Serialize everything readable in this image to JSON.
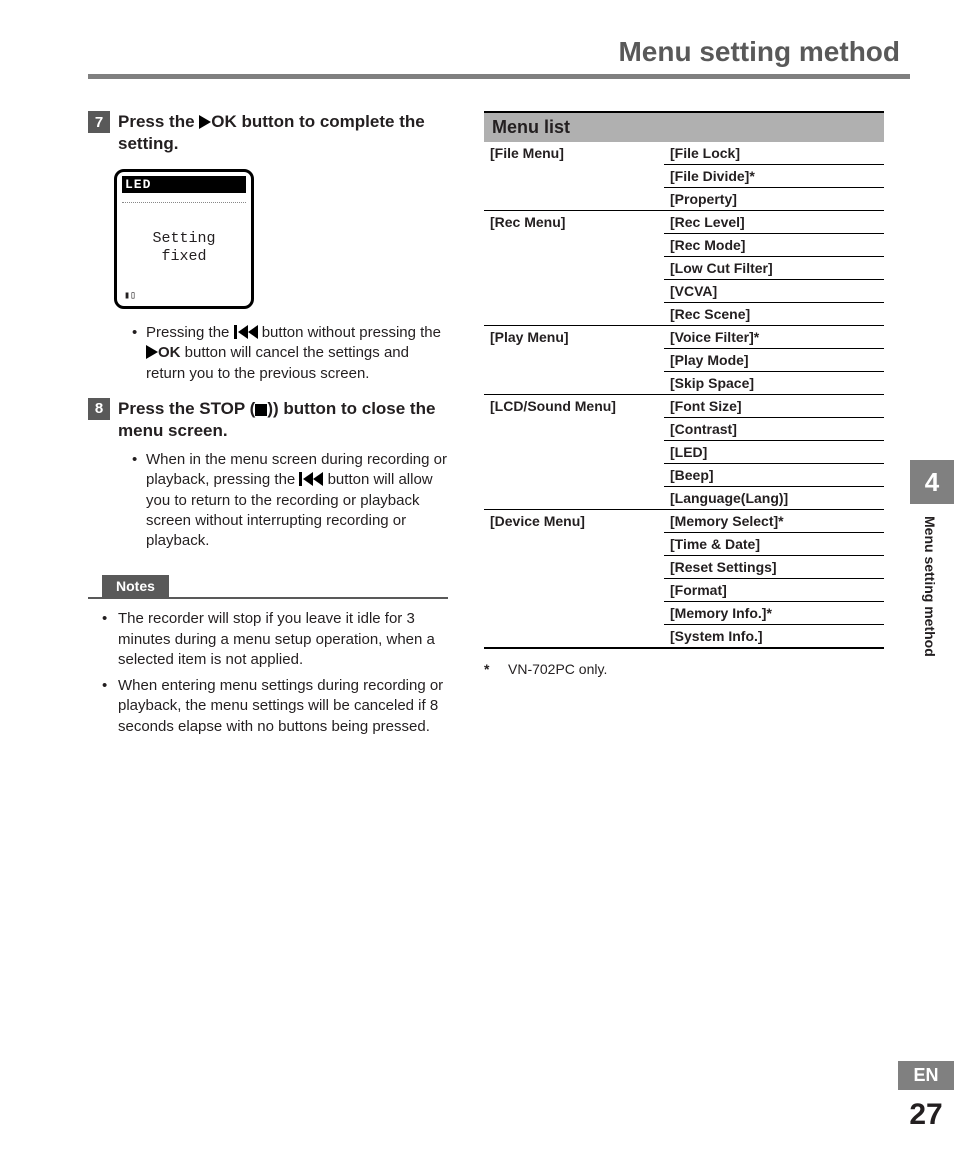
{
  "header": {
    "title": "Menu setting method"
  },
  "steps": {
    "s7": {
      "num": "7",
      "pre": "Press the ",
      "ok": "OK",
      "post": " button to complete the setting."
    },
    "s8": {
      "num": "8",
      "pre": "Press the ",
      "stop": "STOP (",
      "post": ") button to close the menu screen."
    }
  },
  "lcd": {
    "top": "LED",
    "line1": "Setting",
    "line2": "fixed"
  },
  "bullets": {
    "b7a_pre": "Pressing the ",
    "b7a_mid": " button without pressing the ",
    "b7a_ok": "OK",
    "b7a_post": " button will cancel the settings and return you to the previous screen.",
    "b8a_pre": "When in the menu screen during recording or playback, pressing the ",
    "b8a_post": " button will allow you to return to the recording or playback screen without interrupting recording or playback."
  },
  "notes": {
    "label": "Notes",
    "items": [
      "The recorder will stop if you leave it idle for 3 minutes during a menu setup operation, when a selected item is not applied.",
      "When entering menu settings during recording or playback, the menu settings will be canceled if 8 seconds elapse with no buttons being pressed."
    ]
  },
  "menulist": {
    "header": "Menu list",
    "rows": [
      {
        "cat": "[File Menu]",
        "item": "[File Lock]"
      },
      {
        "cat": "",
        "item": "[File Divide]*"
      },
      {
        "cat": "",
        "item": "[Property]"
      },
      {
        "cat": "[Rec Menu]",
        "item": "[Rec Level]",
        "line": true
      },
      {
        "cat": "",
        "item": "[Rec Mode]"
      },
      {
        "cat": "",
        "item": "[Low Cut Filter]"
      },
      {
        "cat": "",
        "item": "[VCVA]"
      },
      {
        "cat": "",
        "item": "[Rec Scene]"
      },
      {
        "cat": "[Play Menu]",
        "item": "[Voice Filter]*",
        "line": true
      },
      {
        "cat": "",
        "item": "[Play Mode]"
      },
      {
        "cat": "",
        "item": "[Skip Space]"
      },
      {
        "cat": "[LCD/Sound Menu]",
        "item": "[Font Size]",
        "line": true
      },
      {
        "cat": "",
        "item": "[Contrast]"
      },
      {
        "cat": "",
        "item": "[LED]"
      },
      {
        "cat": "",
        "item": "[Beep]"
      },
      {
        "cat": "",
        "item": "[Language(Lang)]"
      },
      {
        "cat": "[Device Menu]",
        "item": "[Memory Select]*",
        "line": true
      },
      {
        "cat": "",
        "item": "[Time & Date]"
      },
      {
        "cat": "",
        "item": "[Reset Settings]"
      },
      {
        "cat": "",
        "item": "[Format]"
      },
      {
        "cat": "",
        "item": "[Memory Info.]*"
      },
      {
        "cat": "",
        "item": "[System Info.]"
      }
    ],
    "footnote_ast": "*",
    "footnote": "VN-702PC only."
  },
  "side": {
    "chapter": "4",
    "title": "Menu setting method"
  },
  "footer": {
    "lang": "EN",
    "page": "27"
  }
}
